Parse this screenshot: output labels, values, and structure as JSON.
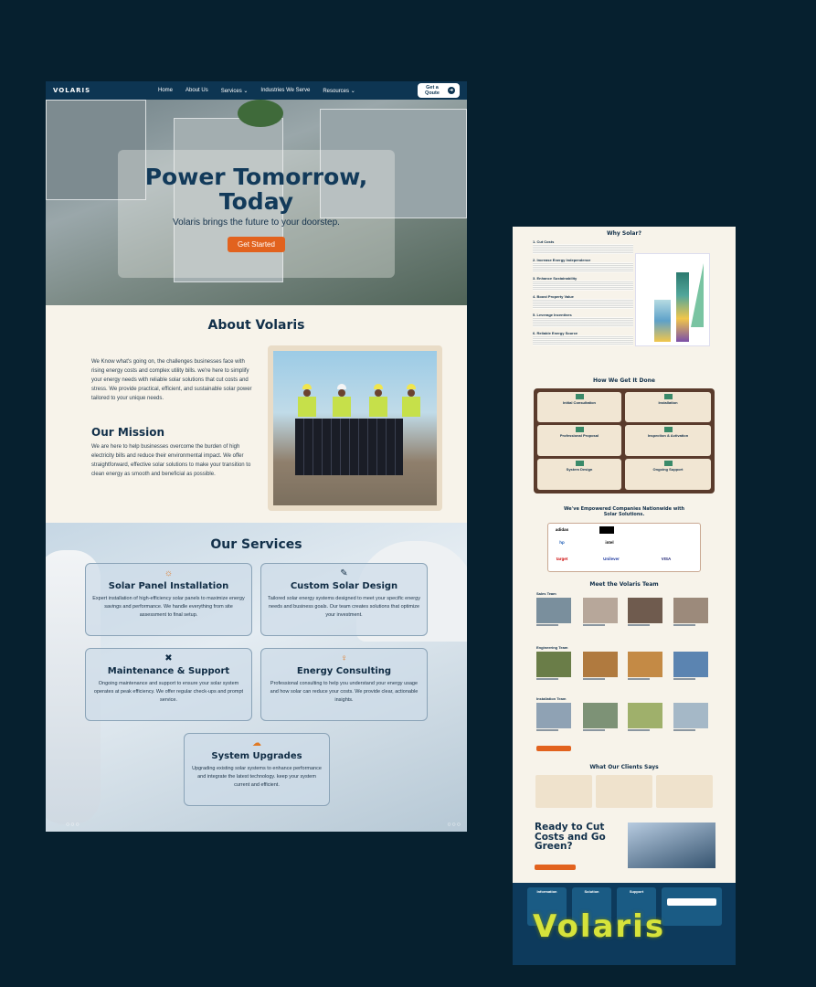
{
  "nav": {
    "logo": "VOLARIS",
    "links": [
      "Home",
      "About Us",
      "Services",
      "Industries We Serve",
      "Resources"
    ],
    "quote_button": "Get a Qoute"
  },
  "hero": {
    "title_line1": "Power Tomorrow,",
    "title_line2": "Today",
    "subtitle": "Volaris brings the future to your doorstep.",
    "cta": "Get Started"
  },
  "about": {
    "heading": "About Volaris",
    "body": "We Know what's going on, the challenges businesses face with rising energy costs and complex utility bills. we're here to simplify your energy needs with reliable solar solutions that cut costs and stress. We provide practical, efficient, and sustainable solar power tailored to your unique needs.",
    "mission_heading": "Our Mission",
    "mission_body": "We are here to help businesses overcome the burden of high electricity bills and reduce their environmental impact. We offer straightforward, effective solar solutions to make your transition to clean energy as smooth and beneficial as possible."
  },
  "services": {
    "heading": "Our Services",
    "items": [
      {
        "title": "Solar Panel Installation",
        "icon": "sun-icon",
        "desc": "Expert installation of high-efficiency solar panels to maximize energy savings and performance. We handle everything from site assessment to final setup."
      },
      {
        "title": "Custom Solar Design",
        "icon": "brush-icon",
        "desc": "Tailored solar energy systems designed to meet your specific energy needs and business goals. Our team creates solutions that optimize your investment."
      },
      {
        "title": "Maintenance & Support",
        "icon": "tools-icon",
        "desc": "Ongoing maintenance and support to ensure your solar system operates at peak efficiency. We offer regular check-ups and prompt service."
      },
      {
        "title": "Energy Consulting",
        "icon": "lightbulb-icon",
        "desc": "Professional consulting to help you understand your energy usage and how solar can reduce your costs. We provide clear, actionable insights."
      },
      {
        "title": "System Upgrades",
        "icon": "cloud-upload-icon",
        "desc": "Upgrading existing solar systems to enhance performance and integrate the latest technology. keep your system current and efficient."
      }
    ]
  },
  "right": {
    "why_heading": "Why Solar?",
    "why_items": [
      "Cut Costs",
      "Increase Energy Independence",
      "Enhance Sustainability",
      "Boost Property Value",
      "Leverage Incentives",
      "Reliable Energy Source"
    ],
    "how_heading": "How We Get It Done",
    "steps": [
      "Initial Consultation",
      "Installation",
      "Professional Proposal",
      "Inspection & Activation",
      "System Design",
      "Ongoing Support"
    ],
    "clients_heading": "We've Empowered Companies Nationwide with Solar Solutions.",
    "clients": [
      "adidas",
      "",
      "",
      "",
      "hp",
      "",
      "intel",
      "",
      "target",
      "",
      "Unilever",
      "VISA"
    ],
    "team_heading": "Meet the Volaris Team",
    "teams": [
      "Sales Team",
      "Engineering Team",
      "Installation Team"
    ],
    "testimonials_heading": "What Our Clients Says",
    "cta_heading": "Ready to Cut Costs and Go Green?",
    "footer_cols": [
      "Information",
      "Solution",
      "Support"
    ],
    "footer_logo": "Volaris"
  }
}
